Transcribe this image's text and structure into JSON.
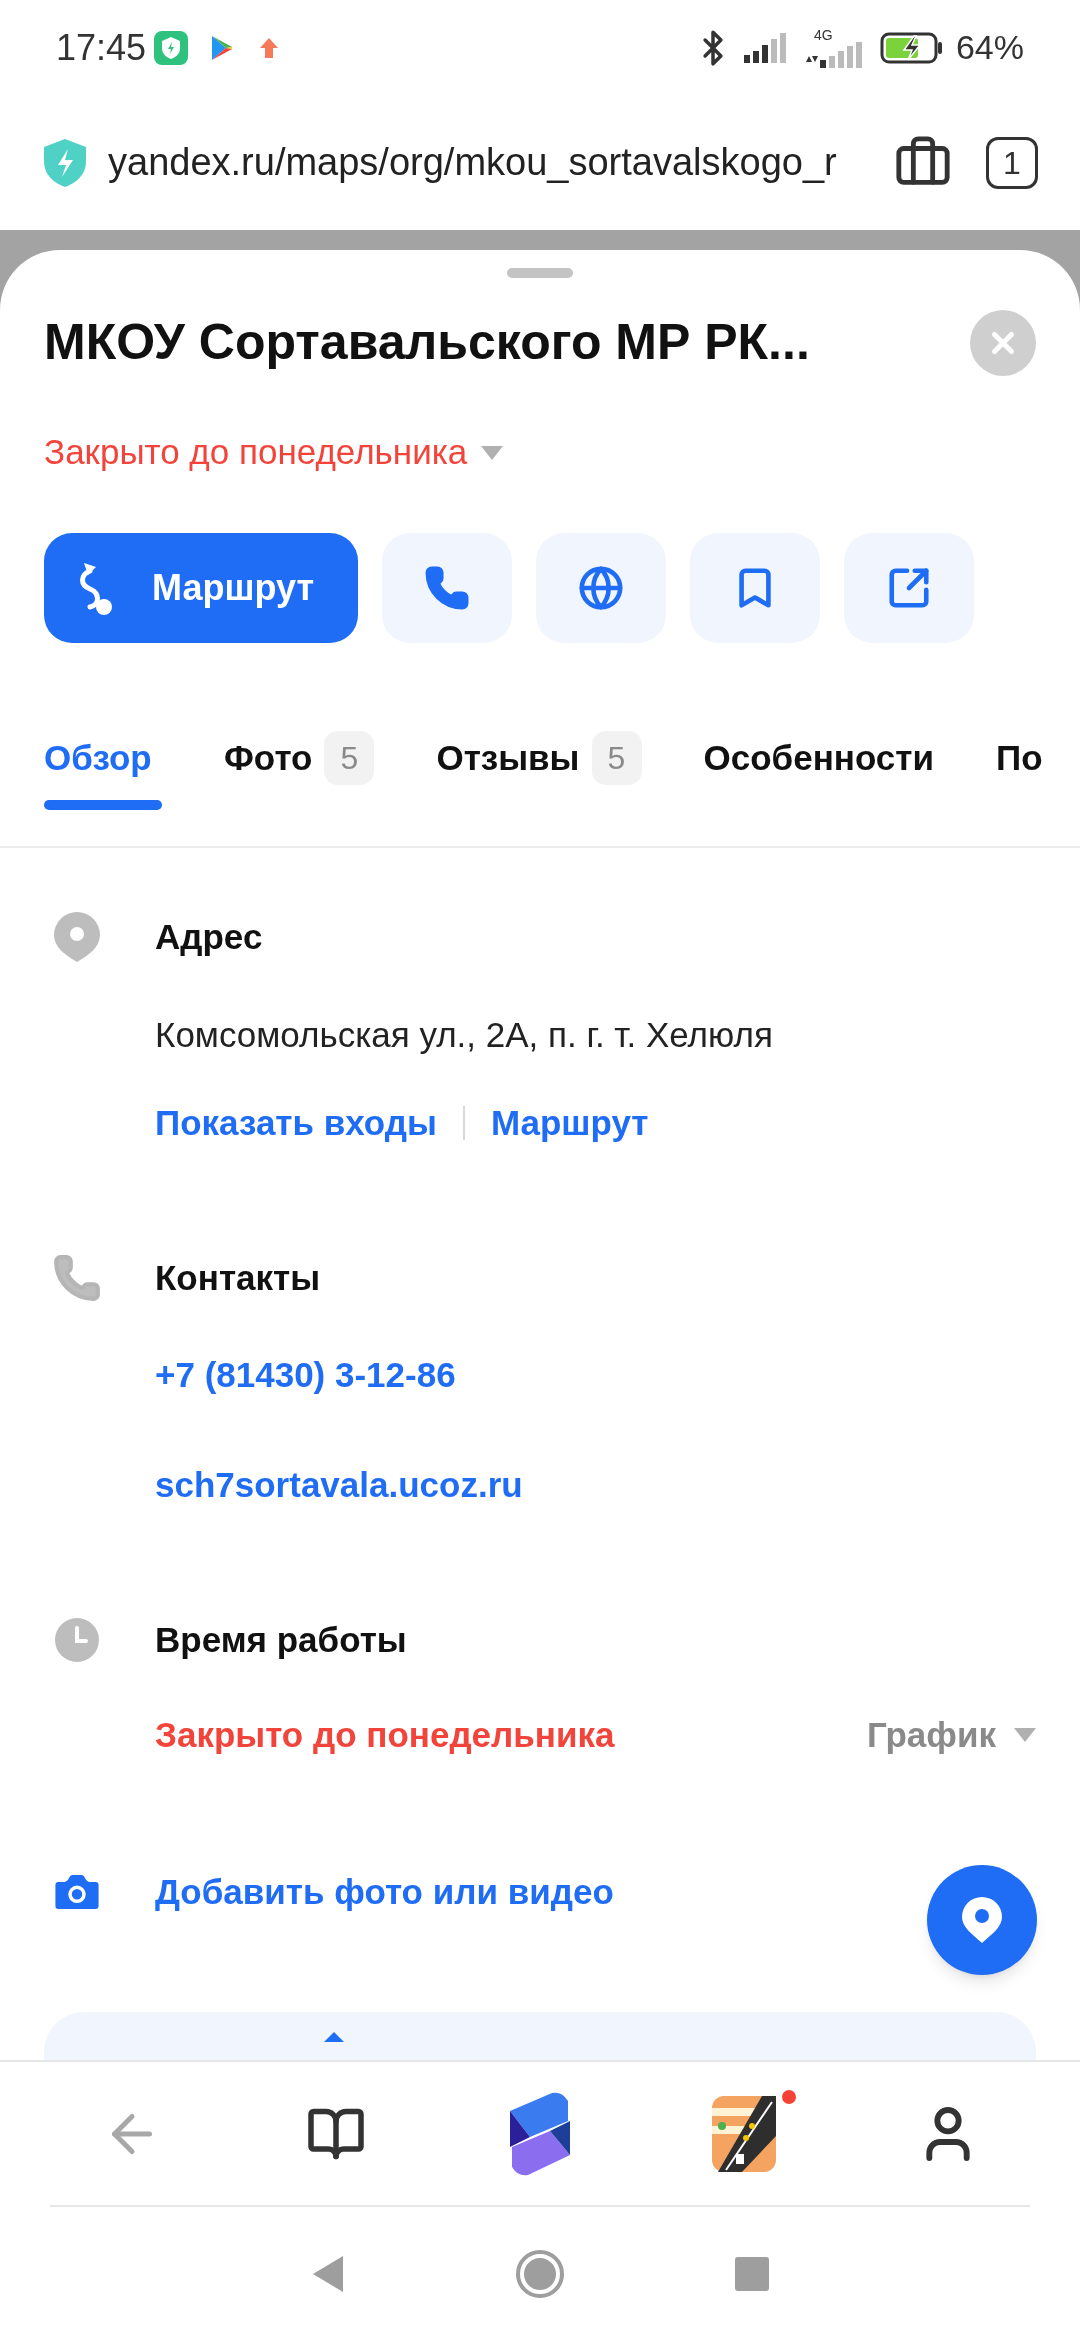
{
  "status_bar": {
    "time": "17:45",
    "network_type": "4G",
    "battery": "64%"
  },
  "browser": {
    "url": "yandex.ru/maps/org/mkou_sortavalskogo_r",
    "tab_count": "1"
  },
  "place": {
    "title": "МКОУ Сортавальского МР РК...",
    "status": "Закрыто до понедельника",
    "actions": [
      {
        "kind": "route",
        "label": "Маршрут"
      },
      {
        "kind": "phone"
      },
      {
        "kind": "web"
      },
      {
        "kind": "bookmark"
      },
      {
        "kind": "share"
      }
    ]
  },
  "tabs": [
    {
      "label": "Обзор",
      "selected": true
    },
    {
      "label": "Фото",
      "count": "5",
      "selected": false
    },
    {
      "label": "Отзывы",
      "count": "5",
      "selected": false
    },
    {
      "label": "Особенности",
      "selected": false
    },
    {
      "label": "По",
      "selected": false
    }
  ],
  "sections": [
    {
      "kind": "address",
      "title": "Адрес",
      "text": "Комсомольская ул., 2А, п. г. т. Хелюля",
      "links": [
        "Показать входы",
        "Маршрут"
      ]
    },
    {
      "kind": "contacts",
      "title": "Контакты",
      "links": [
        "+7 (81430) 3-12-86",
        "sch7sortavala.ucoz.ru"
      ]
    },
    {
      "kind": "hours",
      "title": "Время работы",
      "status": "Закрыто до понедельника",
      "schedule": "График"
    }
  ],
  "add_photo": "Добавить фото или видео",
  "bottom_nav": [
    {
      "kind": "back"
    },
    {
      "kind": "book"
    },
    {
      "kind": "assistant"
    },
    {
      "kind": "game",
      "notification": true
    },
    {
      "kind": "profile"
    }
  ]
}
